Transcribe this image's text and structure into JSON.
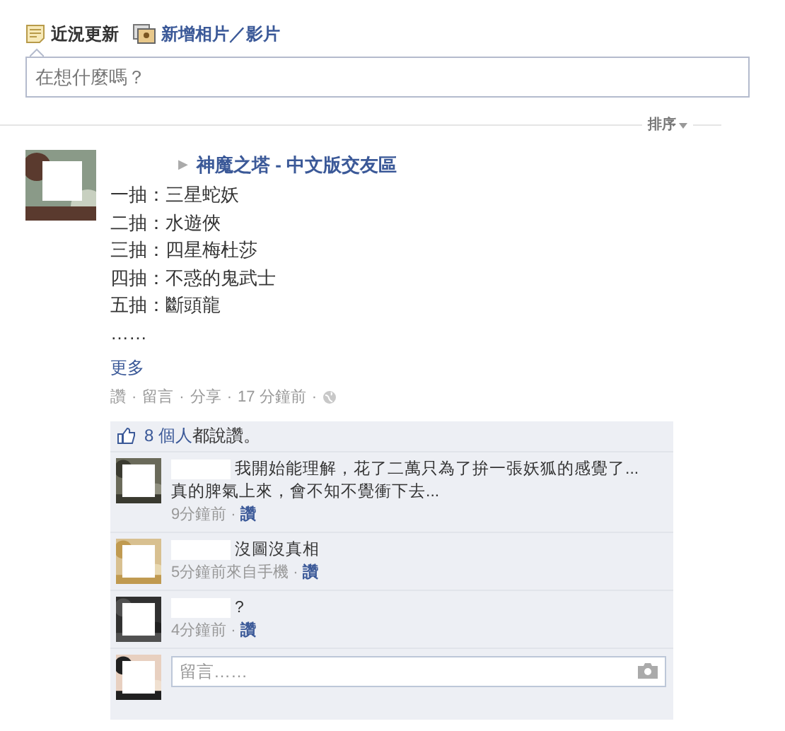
{
  "composer": {
    "tabs": [
      {
        "label": "近況更新",
        "selected": true
      },
      {
        "label": "新增相片／影片",
        "selected": false
      }
    ],
    "placeholder": "在想什麼嗎？"
  },
  "sort": {
    "label": "排序"
  },
  "post": {
    "arrow": "▶",
    "group": "神魔之塔 - 中文版交友區",
    "lines": [
      "一抽：三星蛇妖",
      "二抽：水遊俠",
      "三抽：四星梅杜莎",
      "四抽：不惑的鬼武士",
      "五抽：斷頭龍",
      "……"
    ],
    "more": "更多",
    "actions": [
      "讚",
      "留言",
      "分享"
    ],
    "time": "17 分鐘前",
    "sep": "·"
  },
  "likes": {
    "count": "8 個人",
    "text": "都說讚。"
  },
  "comments": [
    {
      "lines": [
        "我開始能理解，花了二萬只為了拚一張妖狐的感覺了...",
        "真的脾氣上來，會不知不覺衝下去..."
      ],
      "time": "9分鐘前",
      "sep": "·",
      "like": "讚"
    },
    {
      "lines": [
        "沒圖沒真相"
      ],
      "time": "5分鐘前來自手機",
      "sep": "·",
      "like": "讚"
    },
    {
      "lines": [
        "?"
      ],
      "time": "4分鐘前",
      "sep": "·",
      "like": "讚"
    }
  ],
  "comment_box": {
    "placeholder": "留言……"
  }
}
